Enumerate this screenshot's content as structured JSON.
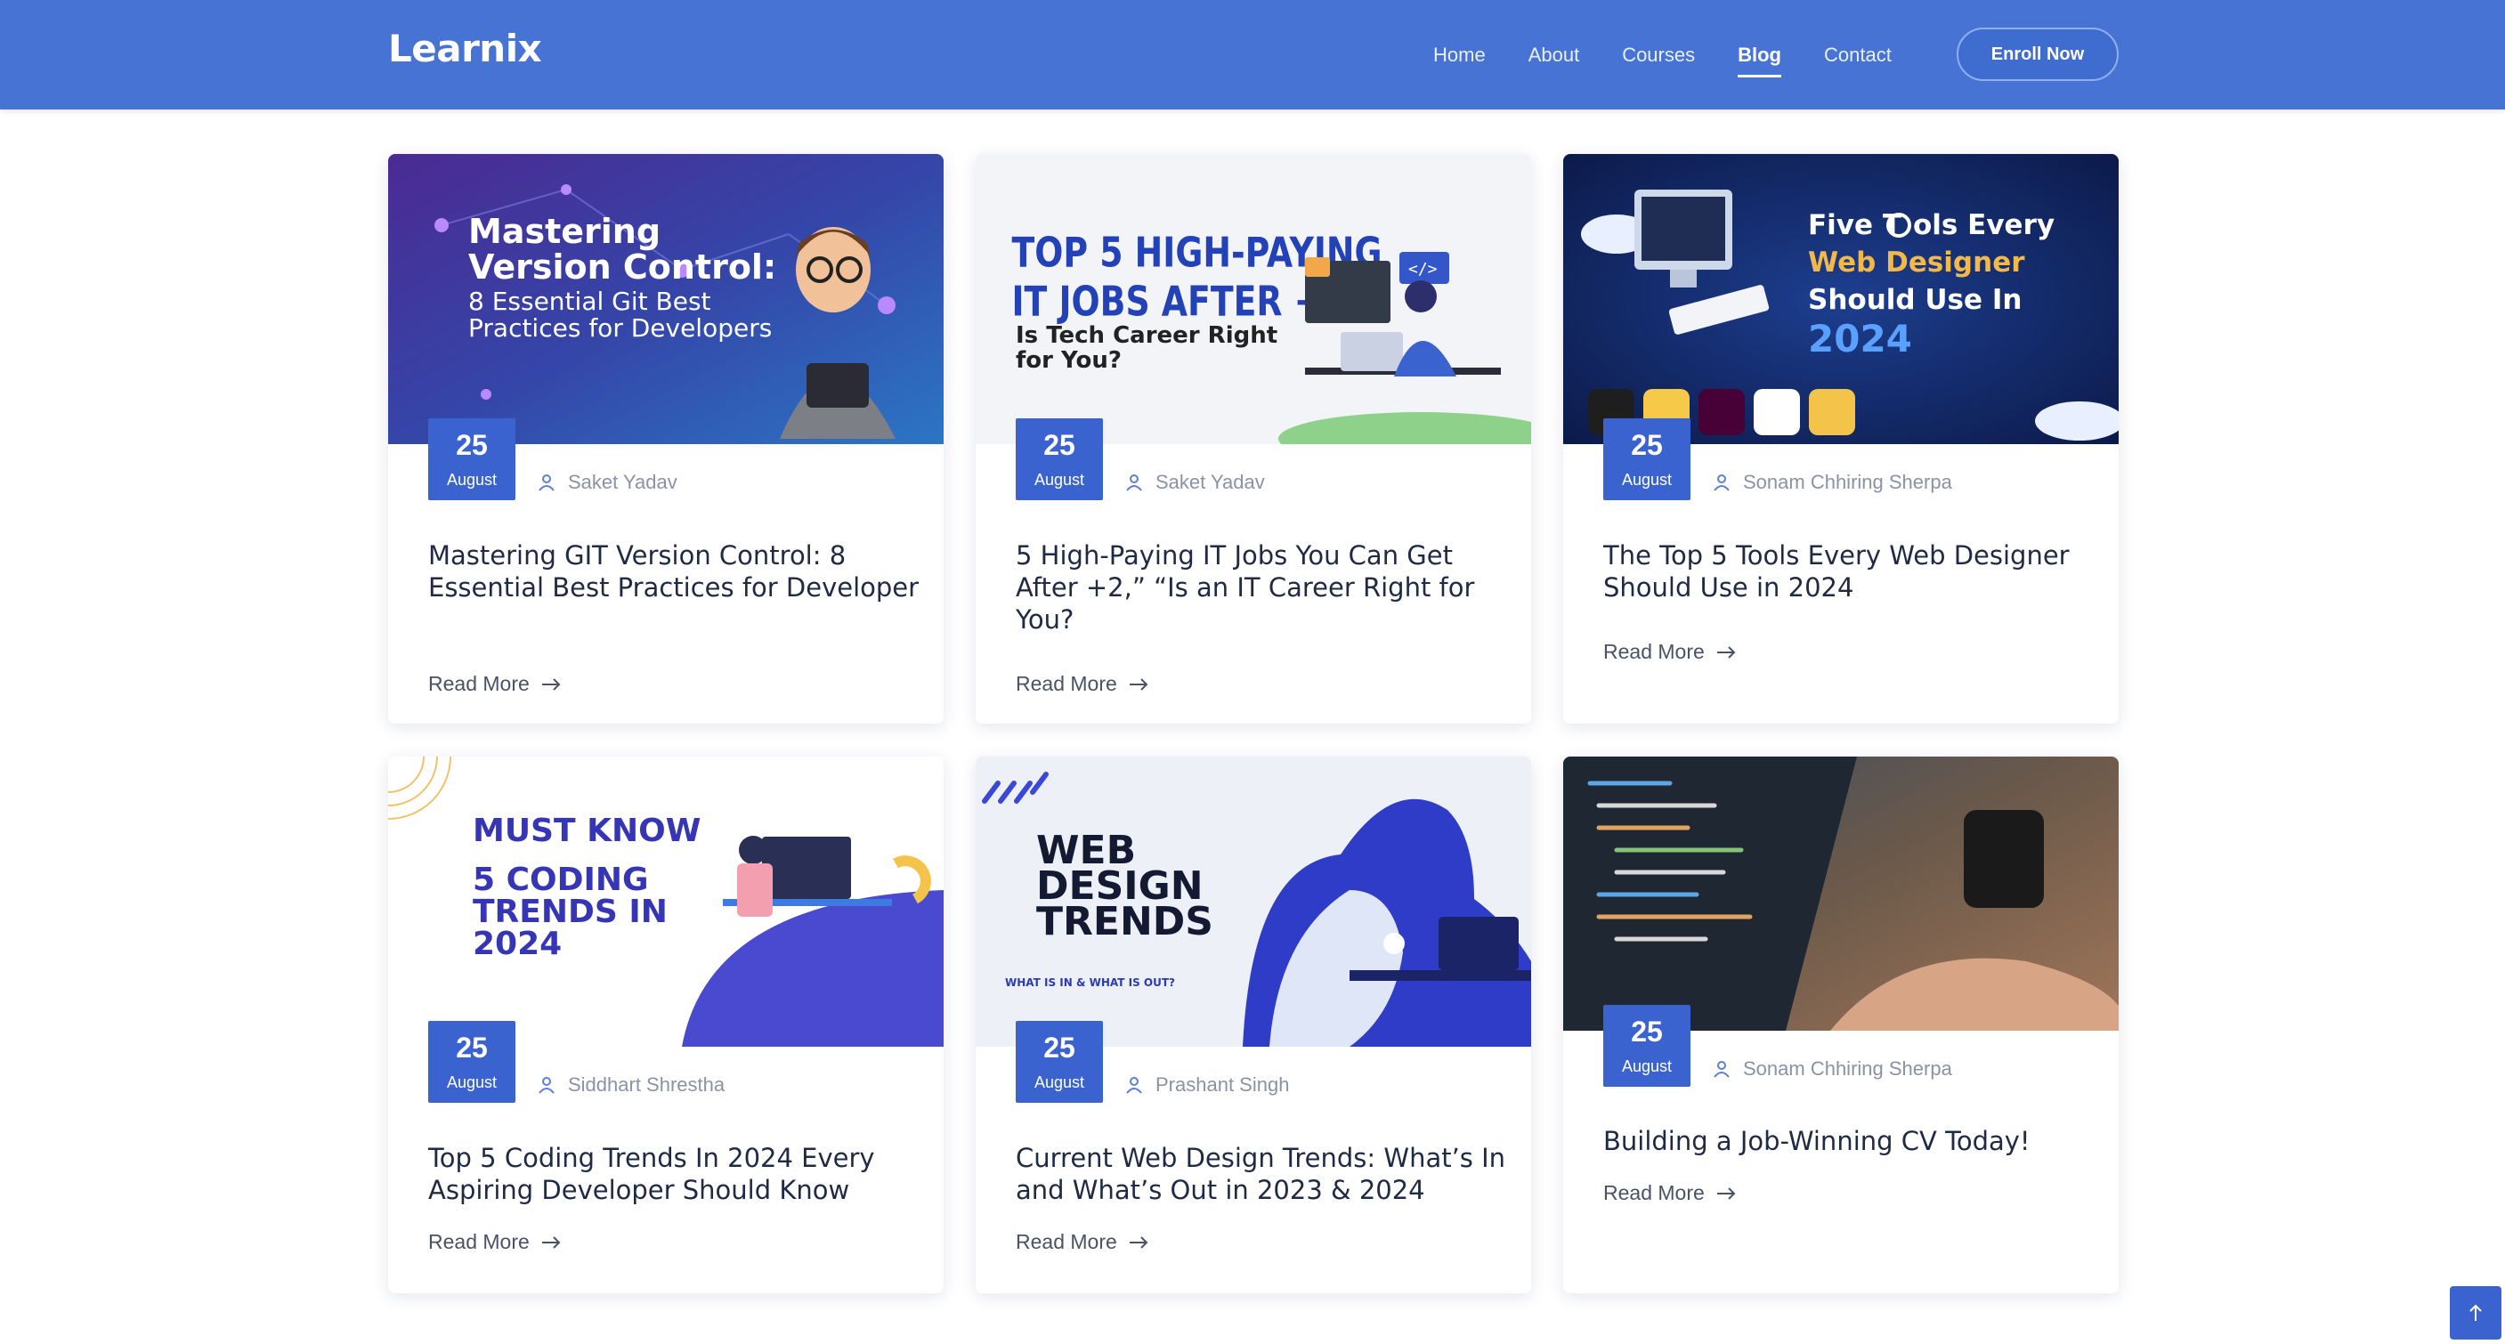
{
  "header": {
    "logo": "Learnix",
    "nav": [
      "Home",
      "About",
      "Courses",
      "Blog",
      "Contact"
    ],
    "active_nav": "Blog",
    "cta": "Enroll Now"
  },
  "cards": [
    {
      "day": "25",
      "month": "August",
      "author": "Saket Yadav",
      "title": "Mastering GIT Version Control: 8 Essential Best Practices for Developer",
      "read_more": "Read More",
      "image_text": [
        "Mastering",
        "Version Control:",
        "8 Essential Git Best",
        "Practices for Developers"
      ]
    },
    {
      "day": "25",
      "month": "August",
      "author": "Saket Yadav",
      "title": "5 High-Paying IT Jobs You Can Get After +2,” “Is an IT Career Right for You?",
      "read_more": "Read More",
      "image_text": [
        "TOP 5 HIGH-PAYING",
        "IT JOBS AFTER +2",
        "Is Tech Career Right",
        "for You?"
      ]
    },
    {
      "day": "25",
      "month": "August",
      "author": "Sonam Chhiring Sherpa",
      "title": "The Top 5 Tools Every Web Designer Should Use in 2024",
      "read_more": "Read More",
      "image_text": [
        "Five T",
        "ols Every",
        "Web Designer",
        "Should Use In",
        "2024"
      ]
    },
    {
      "day": "25",
      "month": "August",
      "author": "Siddhart Shrestha",
      "title": "Top 5 Coding Trends In 2024 Every Aspiring Developer Should Know",
      "read_more": "Read More",
      "image_text": [
        "MUST KNOW",
        "5 CODING",
        "TRENDS IN",
        "2024"
      ]
    },
    {
      "day": "25",
      "month": "August",
      "author": "Prashant Singh",
      "title": "Current Web Design Trends: What’s In and What’s Out in 2023 & 2024",
      "read_more": "Read More",
      "image_text": [
        "WEB",
        "DESIGN",
        "TRENDS",
        "WHAT IS IN & WHAT IS OUT?"
      ]
    },
    {
      "day": "25",
      "month": "August",
      "author": "Sonam Chhiring Sherpa",
      "title": "Building a Job-Winning CV Today!",
      "read_more": "Read More",
      "image_text": []
    }
  ],
  "colors": {
    "header": "#4673d4",
    "accent": "#3b63d0"
  },
  "icons": [
    "user-icon",
    "arrow-right-icon",
    "arrow-up-icon"
  ]
}
